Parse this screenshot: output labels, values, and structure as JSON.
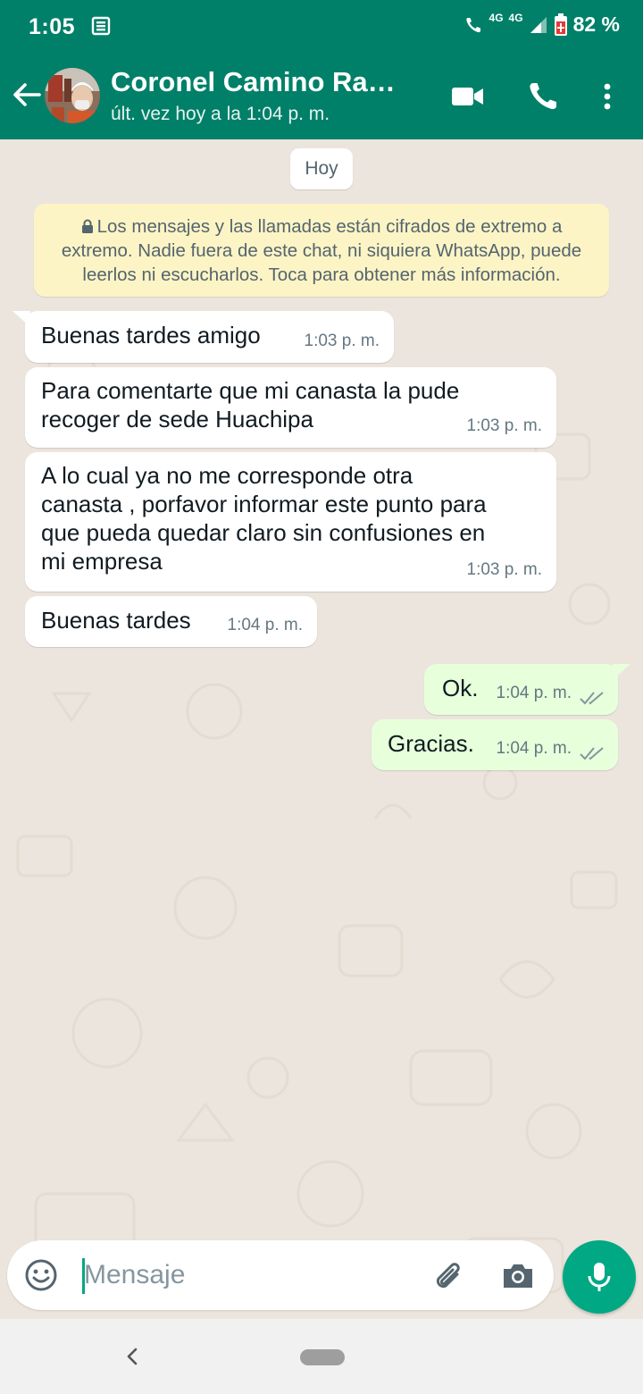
{
  "status_bar": {
    "time": "1:05",
    "network_1": "4G",
    "network_2": "4G",
    "battery": "82 %"
  },
  "header": {
    "contact_name": "Coronel Camino Ramir…",
    "last_seen": "últ. vez hoy a la 1:04 p. m.",
    "icons": [
      "back-arrow-icon",
      "video-call-icon",
      "phone-icon",
      "more-vert-icon"
    ]
  },
  "chat": {
    "date_chip": "Hoy",
    "encryption_notice": [
      "Los mensajes y las llamadas están cifrados de extremo a",
      "extremo. Nadie fuera de este chat, ni siquiera WhatsApp, puede",
      "leerlos ni escucharlos. Toca para obtener más información."
    ],
    "messages": [
      {
        "direction": "in",
        "lines": [
          "Buenas tardes amigo"
        ],
        "time": "1:03 p. m."
      },
      {
        "direction": "in",
        "lines": [
          "Para comentarte que mi canasta la pude",
          "recoger de sede Huachipa"
        ],
        "time": "1:03 p. m."
      },
      {
        "direction": "in",
        "lines": [
          "A lo cual ya no me corresponde otra",
          "canasta , porfavor informar este punto para",
          "que pueda quedar claro sin confusiones en",
          "mi empresa"
        ],
        "time": "1:03 p. m."
      },
      {
        "direction": "in",
        "lines": [
          "Buenas tardes"
        ],
        "time": "1:04 p. m."
      },
      {
        "direction": "out",
        "lines": [
          "Ok."
        ],
        "time": "1:04 p. m.",
        "status": "read-double-check"
      },
      {
        "direction": "out",
        "lines": [
          "Gracias."
        ],
        "time": "1:04 p. m.",
        "status": "read-double-check"
      }
    ]
  },
  "composer": {
    "placeholder": "Mensaje"
  },
  "colors": {
    "header_bg": "#008069",
    "chat_bg": "#ece5dd",
    "outgoing_bubble": "#e7ffdb",
    "encryption_bg": "#fdf4c5",
    "mic_button": "#00a884"
  }
}
